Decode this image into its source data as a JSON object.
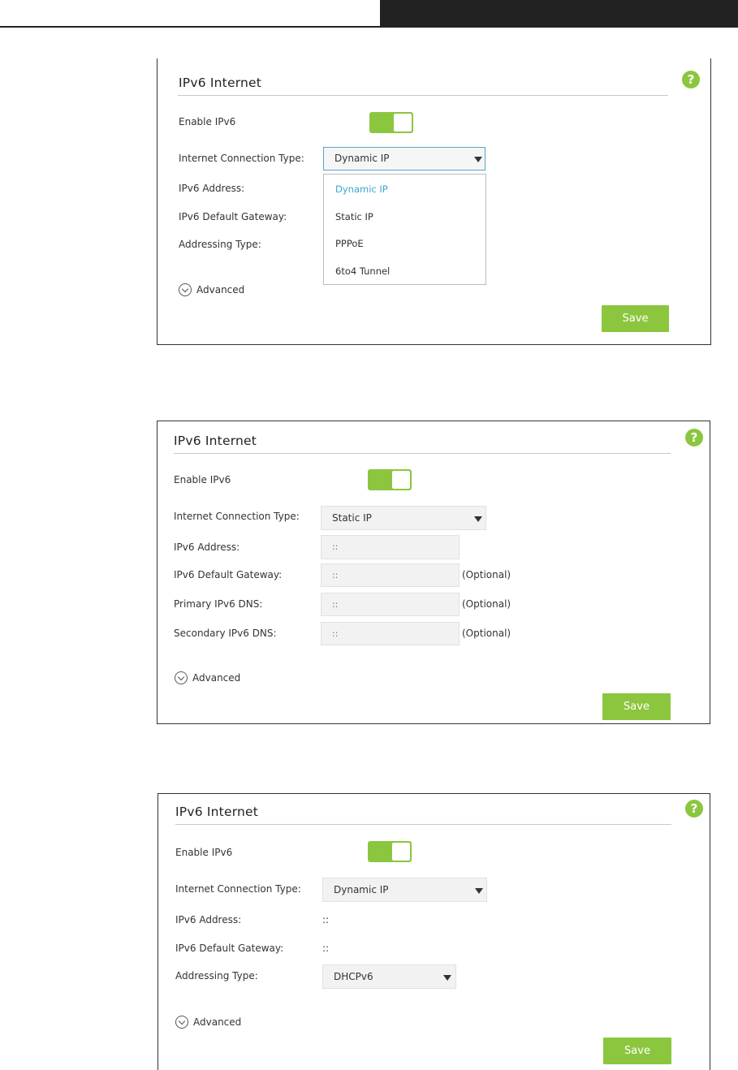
{
  "colors": {
    "accent_green": "#8cc63f",
    "selected_option_blue": "#3aa6d0",
    "header_dark": "#222222"
  },
  "panel1": {
    "title": "IPv6 Internet",
    "help_icon_text": "?",
    "enable_label": "Enable IPv6",
    "enable_on": true,
    "conn_type_label": "Internet Connection Type:",
    "conn_type_value": "Dynamic IP",
    "ipv6_address_label": "IPv6 Address:",
    "ipv6_gateway_label": "IPv6 Default Gateway:",
    "addressing_type_label": "Addressing Type:",
    "dropdown_options": [
      "Dynamic IP",
      "Static IP",
      "PPPoE",
      "6to4 Tunnel"
    ],
    "dropdown_selected": "Dynamic IP",
    "advanced_label": "Advanced",
    "save_label": "Save"
  },
  "panel2": {
    "title": "IPv6 Internet",
    "help_icon_text": "?",
    "enable_label": "Enable IPv6",
    "enable_on": true,
    "conn_type_label": "Internet Connection Type:",
    "conn_type_value": "Static IP",
    "ipv6_address_label": "IPv6 Address:",
    "ipv6_address_value": "::",
    "ipv6_gateway_label": "IPv6 Default Gateway:",
    "ipv6_gateway_value": "::",
    "primary_dns_label": "Primary IPv6 DNS:",
    "primary_dns_value": "::",
    "secondary_dns_label": "Secondary IPv6 DNS:",
    "secondary_dns_value": "::",
    "optional_note": "(Optional)",
    "advanced_label": "Advanced",
    "save_label": "Save"
  },
  "panel3": {
    "title": "IPv6 Internet",
    "help_icon_text": "?",
    "enable_label": "Enable IPv6",
    "enable_on": true,
    "conn_type_label": "Internet Connection Type:",
    "conn_type_value": "Dynamic IP",
    "ipv6_address_label": "IPv6 Address:",
    "ipv6_address_value": "::",
    "ipv6_gateway_label": "IPv6 Default Gateway:",
    "ipv6_gateway_value": "::",
    "addressing_type_label": "Addressing Type:",
    "addressing_type_value": "DHCPv6",
    "advanced_label": "Advanced",
    "save_label": "Save"
  }
}
